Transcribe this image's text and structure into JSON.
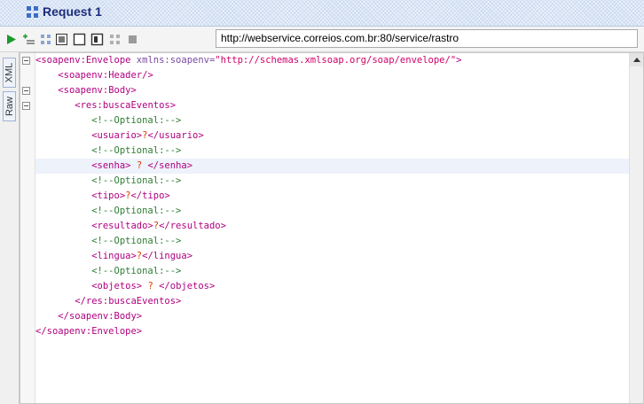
{
  "window": {
    "title": "Request 1"
  },
  "toolbar": {
    "url": "http://webservice.correios.com.br:80/service/rastro"
  },
  "side_tabs": [
    "XML",
    "Raw"
  ],
  "code": {
    "env_open": "<soapenv:Envelope",
    "env_attr": "xmlns:soapenv=",
    "env_ns": "\"http://schemas.xmlsoap.org/soap/envelope/\"",
    "env_gt": ">",
    "header": "<soapenv:Header/>",
    "body_open": "<soapenv:Body>",
    "busca_open": "<res:buscaEventos>",
    "comment": "<!--Optional:-->",
    "usuario_open": "<usuario>",
    "usuario_close": "</usuario>",
    "senha_open": "<senha>",
    "senha_close": "</senha>",
    "tipo_open": "<tipo>",
    "tipo_close": "</tipo>",
    "resultado_open": "<resultado>",
    "resultado_close": "</resultado>",
    "lingua_open": "<lingua>",
    "lingua_close": "</lingua>",
    "objetos_open": "<objetos>",
    "objetos_close": "</objetos>",
    "placeholder": "?",
    "busca_close": "</res:buscaEventos>",
    "body_close": "</soapenv:Body>",
    "env_close": "</soapenv:Envelope>"
  }
}
